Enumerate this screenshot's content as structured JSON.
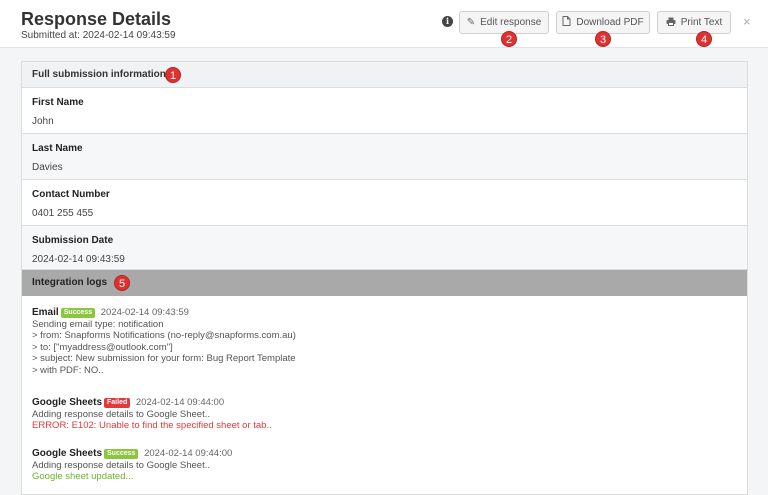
{
  "header": {
    "title": "Response Details",
    "submitted": "Submitted at: 2024-02-14 09:43:59",
    "info_icon": "i",
    "buttons": {
      "edit": "Edit response",
      "download": "Download PDF",
      "print": "Print Text"
    },
    "close": "×"
  },
  "markers": [
    "1",
    "2",
    "3",
    "4",
    "5"
  ],
  "submission": {
    "heading": "Full submission information",
    "fields": [
      {
        "label": "First Name",
        "value": "John"
      },
      {
        "label": "Last Name",
        "value": "Davies"
      },
      {
        "label": "Contact Number",
        "value": "0401 255 455"
      },
      {
        "label": "Submission Date",
        "value": "2024-02-14 09:43:59"
      }
    ]
  },
  "integration": {
    "heading": "Integration logs",
    "logs": [
      {
        "name": "Email",
        "status": "Success",
        "time": "2024-02-14 09:43:59",
        "lines": [
          "Sending email type: notification",
          "> from: Snapforms Notifications (no-reply@snapforms.com.au)",
          "> to: [\"myaddress@outlook.com\"]",
          "> subject: New submission for your form: Bug Report Template",
          "> with PDF: NO.."
        ]
      },
      {
        "name": "Google Sheets",
        "status": "Failed",
        "time": "2024-02-14 09:44:00",
        "lines": [
          "Adding response details to Google Sheet.."
        ],
        "error": "ERROR: E102: Unable to find the specified sheet or tab.."
      },
      {
        "name": "Google Sheets",
        "status": "Success",
        "time": "2024-02-14 09:44:00",
        "lines": [
          "Adding response details to Google Sheet.."
        ],
        "result": "Google sheet updated..."
      }
    ]
  },
  "colors": {
    "success": "#8cc63f",
    "failed": "#e0393e",
    "marker": "#e03131",
    "integration_header": "#a9a9a9"
  }
}
